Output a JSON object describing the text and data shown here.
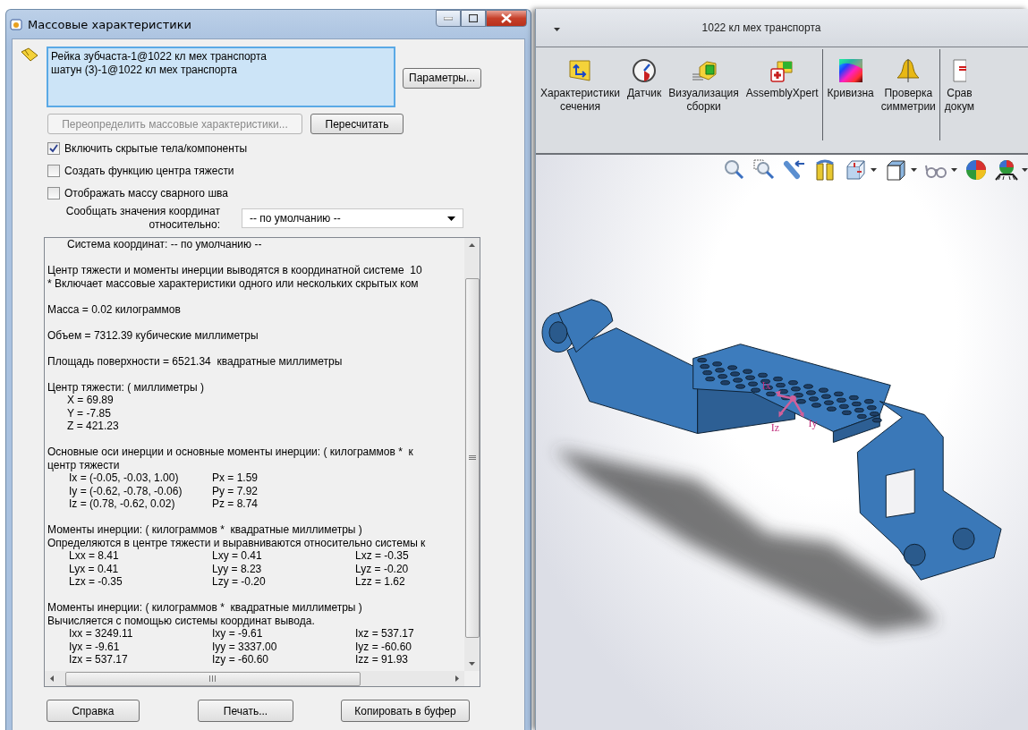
{
  "dialog": {
    "title": "Массовые характеристики",
    "components": [
      "Рейка зубчаста-1@1022 кл мех транспорта",
      "шатун (3)-1@1022 кл мех транспорта"
    ],
    "options_button": "Параметры...",
    "override_button": {
      "label": "Переопределить массовые характеристики...",
      "disabled": true
    },
    "recalculate_button": {
      "label": "Пересчитать",
      "disabled": false
    },
    "checkboxes": [
      {
        "label": "Включить скрытые тела/компоненты",
        "checked": true
      },
      {
        "label": "Создать функцию центра тяжести",
        "checked": false
      },
      {
        "label": "Отображать массу сварного шва",
        "checked": false
      }
    ],
    "coordinate_label": "Сообщать значения координат\nотносительно:",
    "coordinate_select": "-- по умолчанию --",
    "report_lines": [
      {
        "kind": "indent",
        "text": "Система координат: -- по умолчанию --"
      },
      {
        "kind": "blank"
      },
      {
        "kind": "text",
        "text": "Центр тяжести и моменты инерции выводятся в координатной системе  10"
      },
      {
        "kind": "text",
        "text": "* Включает массовые характеристики одного или нескольких скрытых ком"
      },
      {
        "kind": "blank"
      },
      {
        "kind": "text",
        "text": "Масса = 0.02 килограммов"
      },
      {
        "kind": "blank"
      },
      {
        "kind": "text",
        "text": "Объем = 7312.39 кубические миллиметры"
      },
      {
        "kind": "blank"
      },
      {
        "kind": "text",
        "text": "Площадь поверхности = 6521.34  квадратные миллиметры"
      },
      {
        "kind": "blank"
      },
      {
        "kind": "text",
        "text": "Центр тяжести: ( миллиметры )"
      },
      {
        "kind": "indent",
        "text": "X = 69.89"
      },
      {
        "kind": "indent",
        "text": "Y = -7.85"
      },
      {
        "kind": "indent",
        "text": "Z = 421.23"
      },
      {
        "kind": "blank"
      },
      {
        "kind": "text",
        "text": "Основные оси инерции и основные моменты инерции: ( килограммов *  к"
      },
      {
        "kind": "text",
        "text": "центр тяжести"
      },
      {
        "kind": "columns",
        "cells": [
          "Ix = (-0.05, -0.03, 1.00)",
          "Px = 1.59"
        ]
      },
      {
        "kind": "columns",
        "cells": [
          "Iy = (-0.62, -0.78, -0.06)",
          "Py = 7.92"
        ]
      },
      {
        "kind": "columns",
        "cells": [
          "Iz = (0.78, -0.62, 0.02)",
          "Pz = 8.74"
        ]
      },
      {
        "kind": "blank"
      },
      {
        "kind": "text",
        "text": "Моменты инерции: ( килограммов *  квадратные миллиметры )"
      },
      {
        "kind": "text",
        "text": "Определяются в центре тяжести и выравниваются относительно системы к"
      },
      {
        "kind": "columns",
        "cells": [
          "Lxx = 8.41",
          "Lxy = 0.41",
          "Lxz = -0.35"
        ]
      },
      {
        "kind": "columns",
        "cells": [
          "Lyx = 0.41",
          "Lyy = 8.23",
          "Lyz = -0.20"
        ]
      },
      {
        "kind": "columns",
        "cells": [
          "Lzx = -0.35",
          "Lzy = -0.20",
          "Lzz = 1.62"
        ]
      },
      {
        "kind": "blank"
      },
      {
        "kind": "text",
        "text": "Моменты инерции: ( килограммов *  квадратные миллиметры )"
      },
      {
        "kind": "text",
        "text": "Вычисляется с помощью системы координат вывода."
      },
      {
        "kind": "columns",
        "cells": [
          "Ixx = 3249.11",
          "Ixy = -9.61",
          "Ixz = 537.17"
        ]
      },
      {
        "kind": "columns",
        "cells": [
          "Iyx = -9.61",
          "Iyy = 3337.00",
          "Iyz = -60.60"
        ]
      },
      {
        "kind": "columns",
        "cells": [
          "Izx = 537.17",
          "Izy = -60.60",
          "Izz = 91.93"
        ]
      }
    ],
    "buttons": [
      "Справка",
      "Печать...",
      "Копировать в буфер"
    ]
  },
  "cad_window": {
    "title": "1022 кл мех транспорта",
    "ribbon_groups": [
      [
        {
          "kind": "section",
          "label": "Характеристики\nсечения"
        },
        {
          "kind": "sensor",
          "label": "Датчик"
        },
        {
          "kind": "visualization",
          "label": "Визуализация\nсборки"
        },
        {
          "kind": "xpert",
          "label": "AssemblyXpert"
        }
      ],
      [
        {
          "kind": "curvature",
          "label": "Кривизна"
        },
        {
          "kind": "symmetry",
          "label": "Проверка\nсимметрии"
        }
      ],
      [
        {
          "kind": "compare",
          "label": "Срав\nдокум"
        }
      ]
    ],
    "axis_labels": [
      "Ix",
      "Iz",
      "Iy"
    ]
  }
}
